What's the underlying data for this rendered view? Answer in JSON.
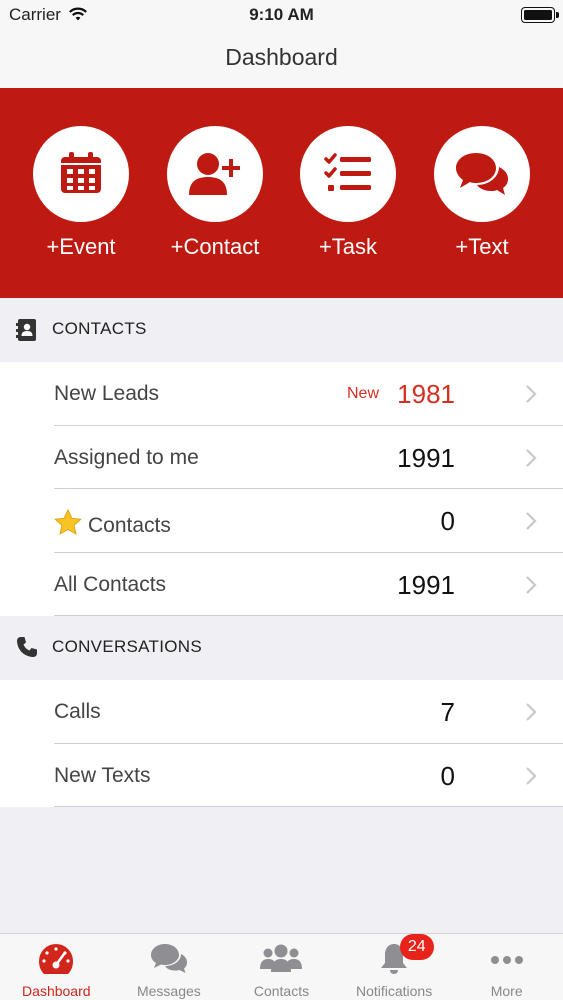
{
  "status_bar": {
    "carrier": "Carrier",
    "time": "9:10 AM"
  },
  "nav": {
    "title": "Dashboard"
  },
  "actions": [
    {
      "label": "+Event",
      "icon": "calendar-icon"
    },
    {
      "label": "+Contact",
      "icon": "add-contact-icon"
    },
    {
      "label": "+Task",
      "icon": "task-list-icon"
    },
    {
      "label": "+Text",
      "icon": "chat-bubbles-icon"
    }
  ],
  "contacts_section": {
    "header": "CONTACTS",
    "icon": "address-book-icon",
    "rows": [
      {
        "label": "New Leads",
        "tag": "New",
        "count": "1981"
      },
      {
        "label": "Assigned to me",
        "count": "1991"
      },
      {
        "label": "Contacts",
        "icon": "star-icon",
        "count": "0"
      },
      {
        "label": "All Contacts",
        "count": "1991"
      }
    ]
  },
  "conversations_section": {
    "header": "CONVERSATIONS",
    "icon": "phone-icon",
    "rows": [
      {
        "label": "Calls",
        "count": "7"
      },
      {
        "label": "New Texts",
        "count": "0"
      }
    ]
  },
  "tabs": [
    {
      "label": "Dashboard",
      "icon": "speedometer-icon",
      "active": true
    },
    {
      "label": "Messages",
      "icon": "chat-icon"
    },
    {
      "label": "Contacts",
      "icon": "people-icon"
    },
    {
      "label": "Notifications",
      "icon": "bell-icon",
      "badge": "24"
    },
    {
      "label": "More",
      "icon": "more-dots-icon"
    }
  ],
  "colors": {
    "accent_red": "#bf1a12",
    "count_red": "#d62e21",
    "badge_red": "#e7231a"
  }
}
